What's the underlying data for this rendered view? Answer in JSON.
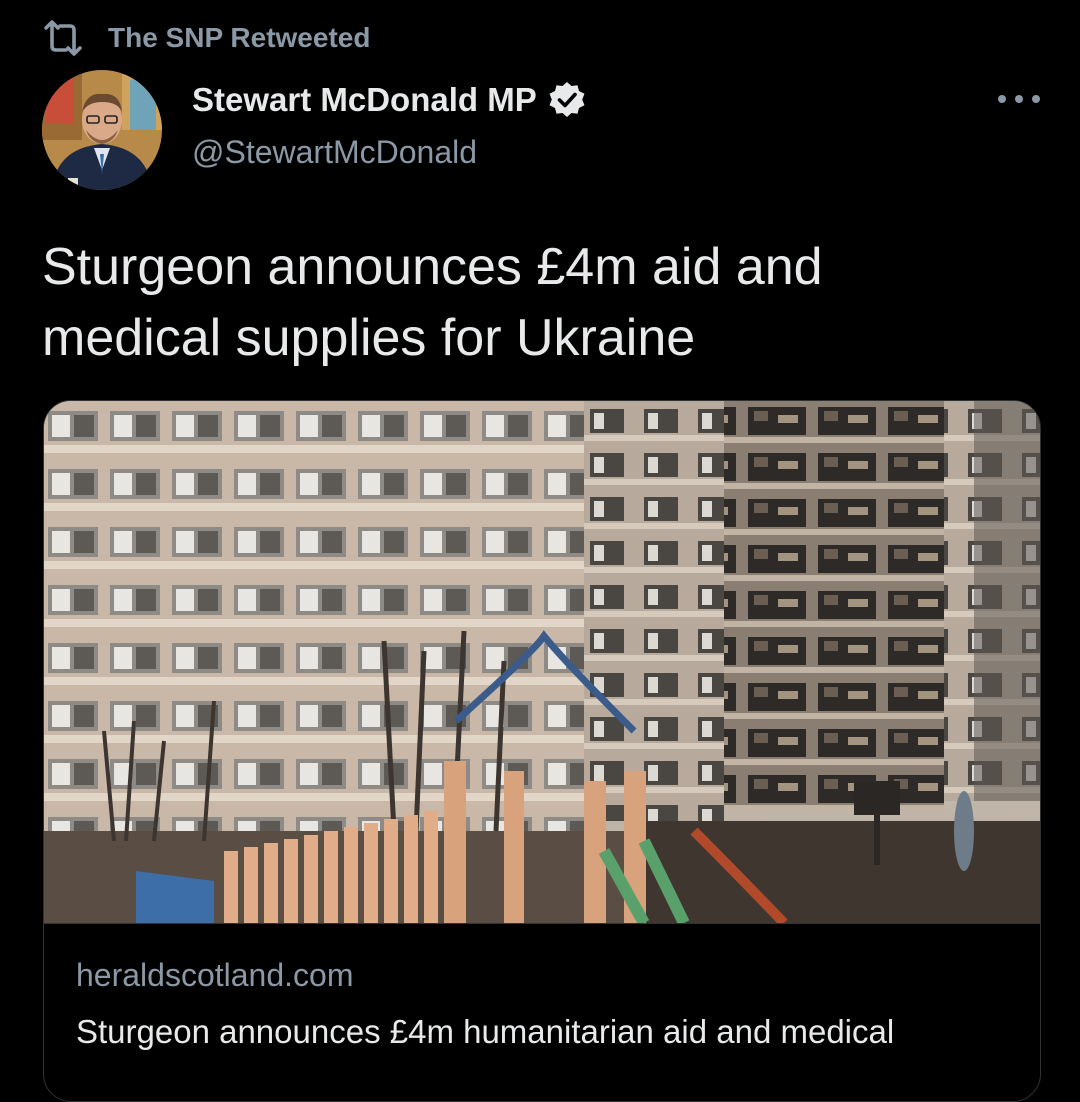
{
  "retweet": {
    "label": "The SNP Retweeted",
    "icon": "retweet-icon"
  },
  "author": {
    "name": "Stewart McDonald MP",
    "handle": "@StewartMcDonald",
    "verified_icon": "verified-badge-icon",
    "avatar_icon": "avatar"
  },
  "menu": {
    "icon": "more-options-icon"
  },
  "tweet": {
    "text": "Sturgeon announces £4m aid and medical supplies for Ukraine"
  },
  "card": {
    "image": "damaged-apartment-building-photo",
    "domain": "heraldscotland.com",
    "title": "Sturgeon announces £4m humanitarian aid and medical"
  },
  "colors": {
    "background": "#000000",
    "text_primary": "#e7e9ea",
    "text_secondary": "#8b98a5",
    "border": "#2f3336",
    "verified_badge": "#e7e9ea"
  }
}
